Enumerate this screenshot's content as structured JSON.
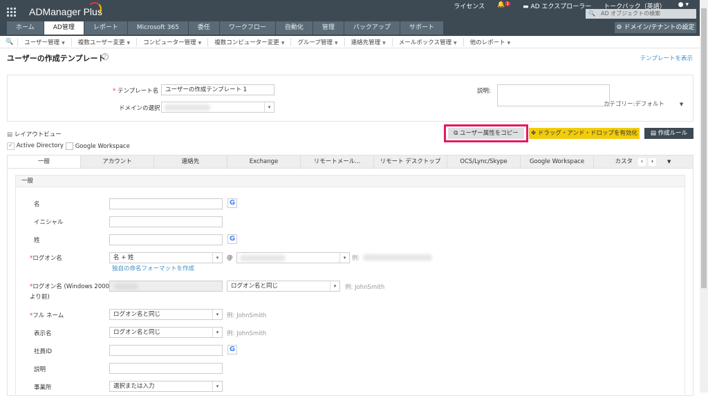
{
  "app": {
    "name": "ADManager Plus"
  },
  "header": {
    "license": "ライセンス",
    "notif_count": "1",
    "ad_explorer": "AD エクスプローラー",
    "feedback": "トークバック（英語）",
    "search_placeholder": "AD オブジェクトの検索",
    "domain_settings": "ドメイン/テナントの設定"
  },
  "tabs": [
    "ホーム",
    "AD管理",
    "レポート",
    "Microsoft 365",
    "委任",
    "ワークフロー",
    "自動化",
    "管理",
    "バックアップ",
    "サポート"
  ],
  "nav": [
    "ユーザー管理",
    "複数ユーザー変更",
    "コンピューター管理",
    "複数コンピューター変更",
    "グループ管理",
    "連絡先管理",
    "メールボックス管理",
    "他のレポート"
  ],
  "page": {
    "title": "ユーザーの作成テンプレート",
    "show_templates": "テンプレートを表示"
  },
  "form": {
    "template_name_label": "テンプレート名",
    "template_name_value": "ユーザーの作成テンプレート 1",
    "domain_label": "ドメインの選択",
    "description_label": "説明:",
    "category": "カテゴリー:デフォルト"
  },
  "toolbar": {
    "layout_view": "レイアウトビュー",
    "active_directory": "Active Directory",
    "google_workspace": "Google Workspace",
    "copy_attrs": "ユーザー属性をコピー",
    "drag_drop": "ドラッグ・アンド・ドロップを有効化",
    "creation_rule": "作成ルール"
  },
  "attr_tabs": [
    "一般",
    "アカウント",
    "連絡先",
    "Exchange",
    "リモートメール...",
    "リモート デスクトップ",
    "OCS/Lync/Skype",
    "Google Workspace",
    "カスタ"
  ],
  "section": {
    "title": "一般",
    "first_name": "名",
    "initials": "イニシャル",
    "last_name": "姓",
    "logon_name": "ログオン名",
    "logon_format": "名 + 姓",
    "at": "@",
    "example_prefix": "例:",
    "custom_format_link": "独自の命名フォーマットを作成",
    "logon_pre2000_line1": "ログオン名 (Windows 2000",
    "logon_pre2000_line2": "より前)",
    "same_as_logon": "ログオン名と同じ",
    "example": "例: JohnSmith",
    "full_name": "フル ネーム",
    "display_name": "表示名",
    "employee_id": "社員ID",
    "description": "説明",
    "office": "事業所",
    "office_placeholder": "選択または入力"
  }
}
